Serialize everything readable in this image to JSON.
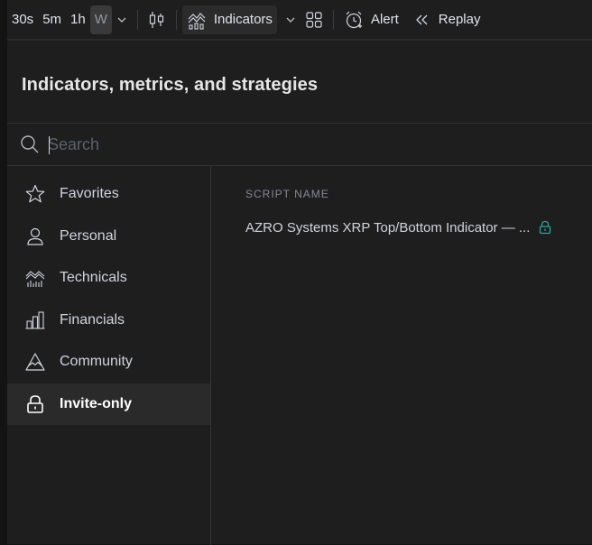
{
  "toolbar": {
    "intervals": [
      "30s",
      "5m",
      "1h",
      "W"
    ],
    "indicators_label": "Indicators",
    "alert_label": "Alert",
    "replay_label": "Replay"
  },
  "dialog": {
    "title": "Indicators, metrics, and strategies",
    "search_placeholder": "Search",
    "categories": [
      {
        "label": "Favorites",
        "icon": "star-icon"
      },
      {
        "label": "Personal",
        "icon": "user-icon"
      },
      {
        "label": "Technicals",
        "icon": "technicals-icon"
      },
      {
        "label": "Financials",
        "icon": "financials-icon"
      },
      {
        "label": "Community",
        "icon": "community-icon"
      },
      {
        "label": "Invite-only",
        "icon": "lock-icon",
        "selected": true
      }
    ],
    "column_header": "SCRIPT NAME",
    "scripts": [
      {
        "name": "AZRO Systems XRP Top/Bottom Indicator — ...",
        "access": "lock-icon"
      }
    ]
  },
  "colors": {
    "background": "#131313",
    "panel": "#1e1e1e",
    "selected_row": "#2a2a2a",
    "lock_green": "#22ab94"
  }
}
